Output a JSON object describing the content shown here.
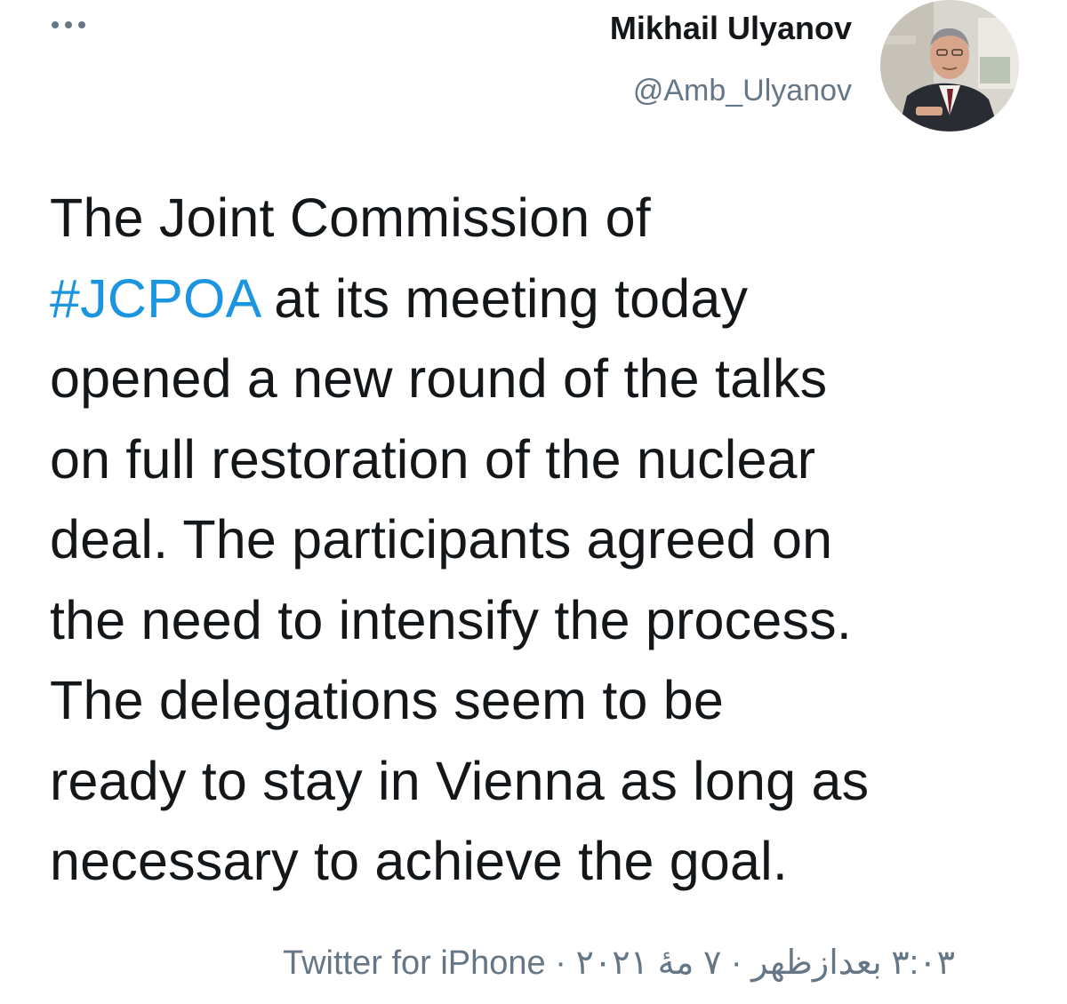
{
  "tweet": {
    "author_name": "Mikhail Ulyanov",
    "author_handle": "@Amb_Ulyanov",
    "body_line1": "The Joint Commission of",
    "hashtag": "#JCPOA",
    "body_line2_rest": " at its meeting today",
    "body_line3": "opened a new round of the talks",
    "body_line4": "on full restoration of the nuclear",
    "body_line5": "deal. The participants agreed on",
    "body_line6": "the need to intensify the process.",
    "body_line7": "The delegations seem to be",
    "body_line8": "ready to stay in Vienna as long as",
    "body_line9": "necessary to achieve the goal.",
    "source": "Twitter for iPhone",
    "separator1": " · ",
    "date": "۷ مهٔ ۲۰۲۱",
    "separator2": " · ",
    "time": "۳:۰۳ بعدازظهر",
    "hashtag_color": "#1b95e0"
  },
  "icons": {
    "more": "more-horizontal-icon"
  }
}
